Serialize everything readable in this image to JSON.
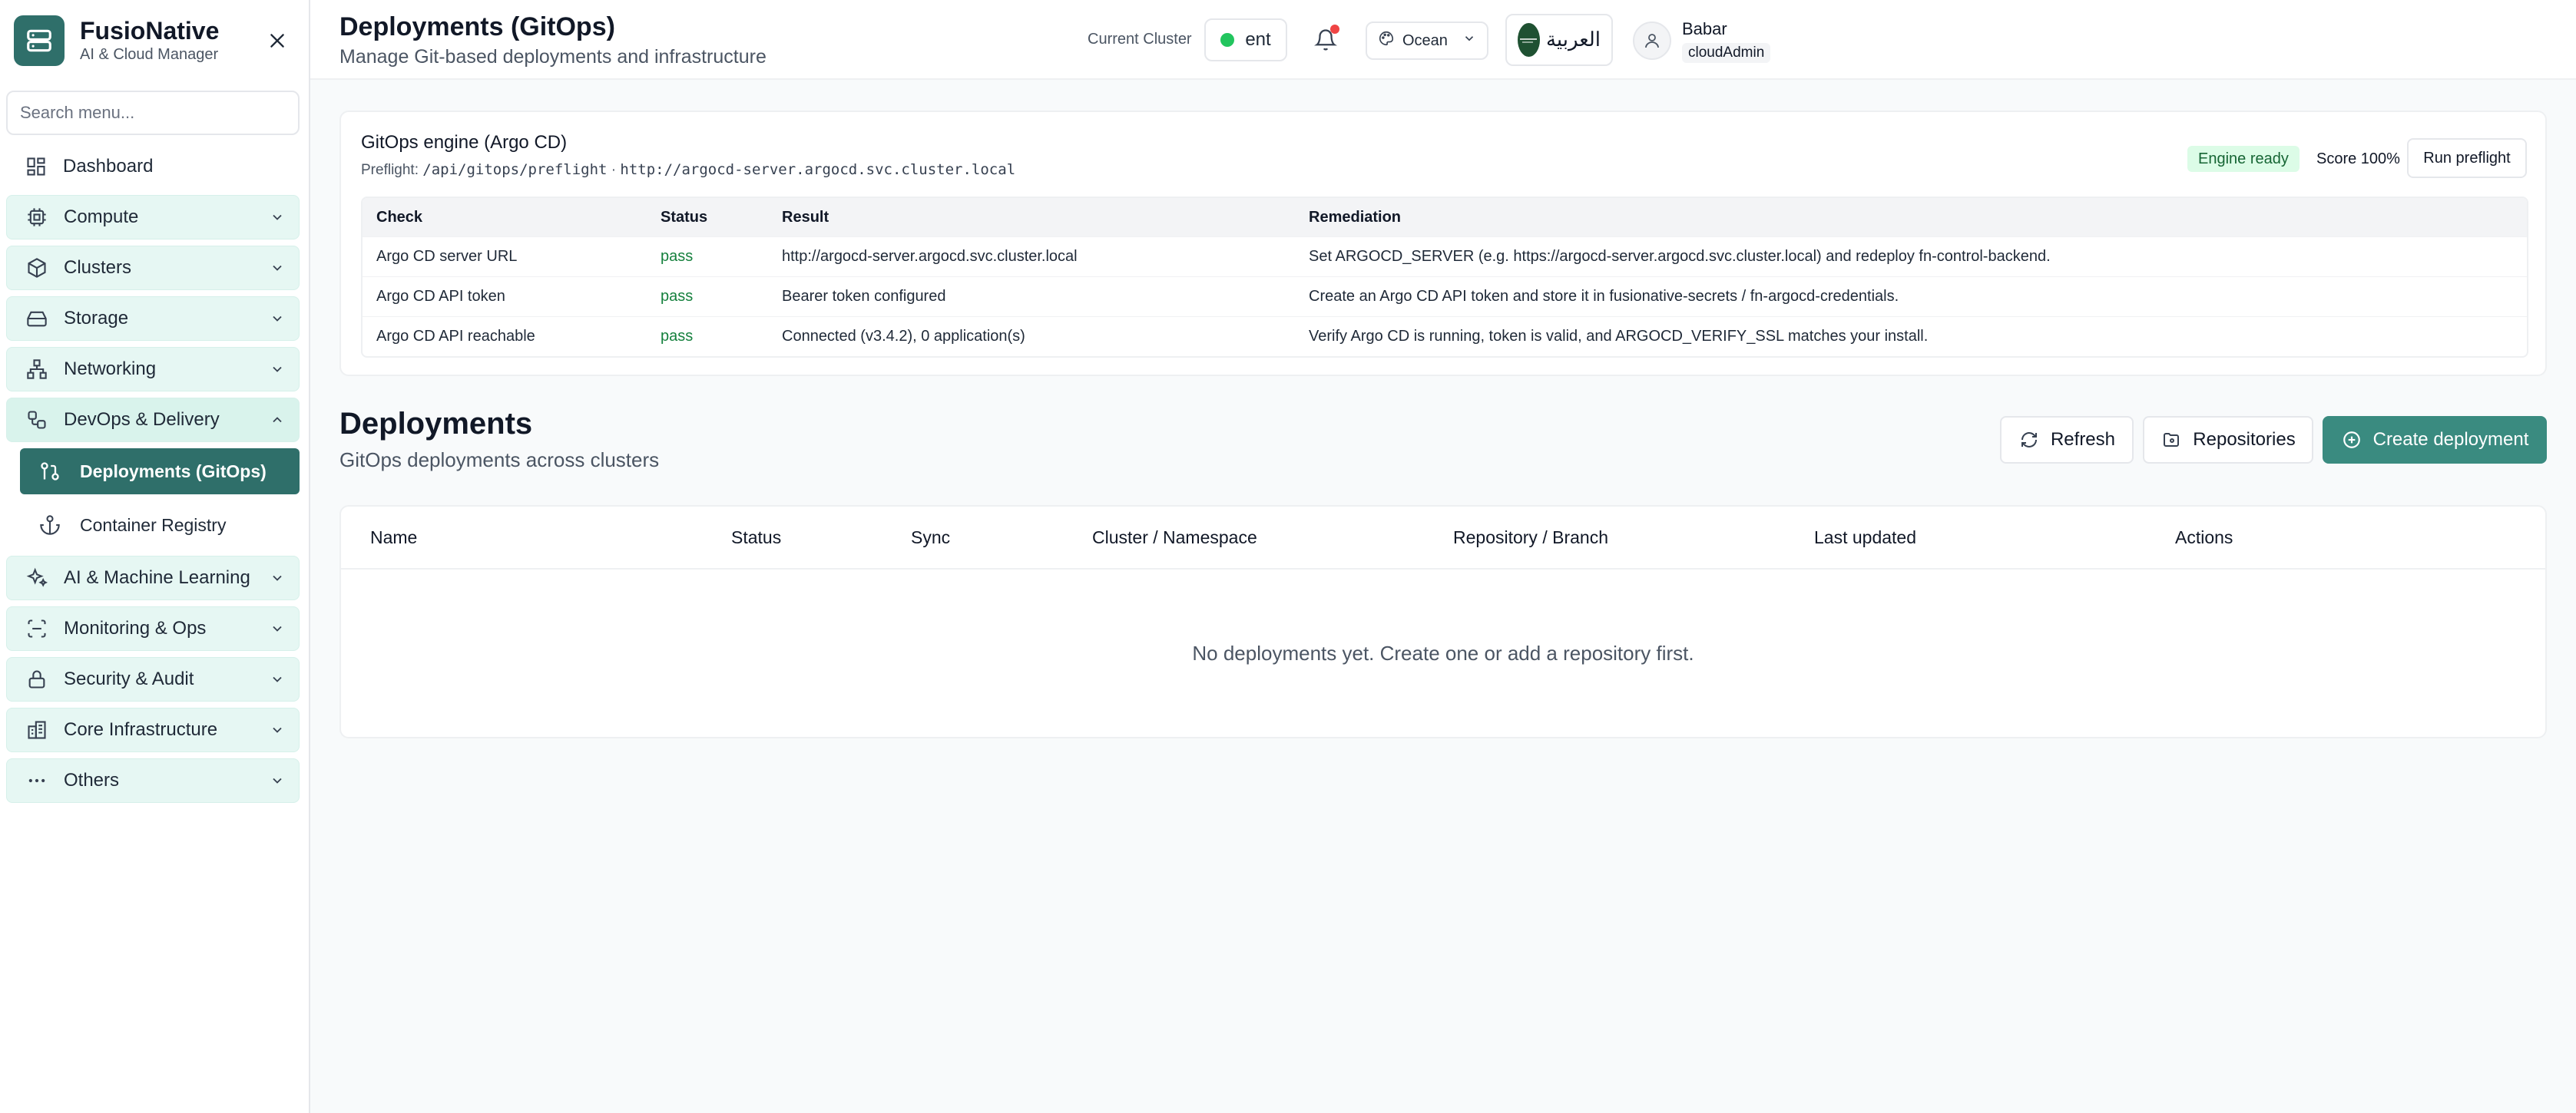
{
  "brand": {
    "name": "FusioNative",
    "subtitle": "AI & Cloud Manager"
  },
  "search": {
    "placeholder": "Search menu..."
  },
  "nav": {
    "dashboard": "Dashboard",
    "compute": "Compute",
    "clusters": "Clusters",
    "storage": "Storage",
    "networking": "Networking",
    "devops": "DevOps & Delivery",
    "devops_items": [
      "Deployments (GitOps)",
      "Container Registry"
    ],
    "ai": "AI & Machine Learning",
    "monitoring": "Monitoring & Ops",
    "security": "Security & Audit",
    "core": "Core Infrastructure",
    "others": "Others"
  },
  "header": {
    "title": "Deployments (GitOps)",
    "subtitle": "Manage Git-based deployments and infrastructure",
    "cluster_label": "Current Cluster",
    "cluster_value": "ent",
    "theme": "Ocean",
    "language": "العربية",
    "user_name": "Babar",
    "user_role": "cloudAdmin"
  },
  "engine": {
    "title": "GitOps engine (Argo CD)",
    "preflight_label": "Preflight:",
    "preflight_path": "/api/gitops/preflight",
    "preflight_sep": "·",
    "preflight_url": "http://argocd-server.argocd.svc.cluster.local",
    "status_badge": "Engine ready",
    "score": "Score 100%",
    "run_button": "Run preflight",
    "columns": [
      "Check",
      "Status",
      "Result",
      "Remediation"
    ],
    "rows": [
      {
        "check": "Argo CD server URL",
        "status": "pass",
        "result": "http://argocd-server.argocd.svc.cluster.local",
        "remediation": "Set ARGOCD_SERVER (e.g. https://argocd-server.argocd.svc.cluster.local) and redeploy fn-control-backend."
      },
      {
        "check": "Argo CD API token",
        "status": "pass",
        "result": "Bearer token configured",
        "remediation": "Create an Argo CD API token and store it in fusionative-secrets / fn-argocd-credentials."
      },
      {
        "check": "Argo CD API reachable",
        "status": "pass",
        "result": "Connected (v3.4.2), 0 application(s)",
        "remediation": "Verify Argo CD is running, token is valid, and ARGOCD_VERIFY_SSL matches your install."
      }
    ]
  },
  "deployments": {
    "title": "Deployments",
    "subtitle": "GitOps deployments across clusters",
    "refresh": "Refresh",
    "repositories": "Repositories",
    "create": "Create deployment",
    "columns": [
      "Name",
      "Status",
      "Sync",
      "Cluster / Namespace",
      "Repository / Branch",
      "Last updated",
      "Actions"
    ],
    "empty": "No deployments yet. Create one or add a repository first."
  },
  "colors": {
    "primary": "#2f6f6a",
    "button": "#3a8b80",
    "nav_group": "#e6f7f3",
    "pass": "#15803d",
    "badge_bg": "#dcfce7"
  }
}
